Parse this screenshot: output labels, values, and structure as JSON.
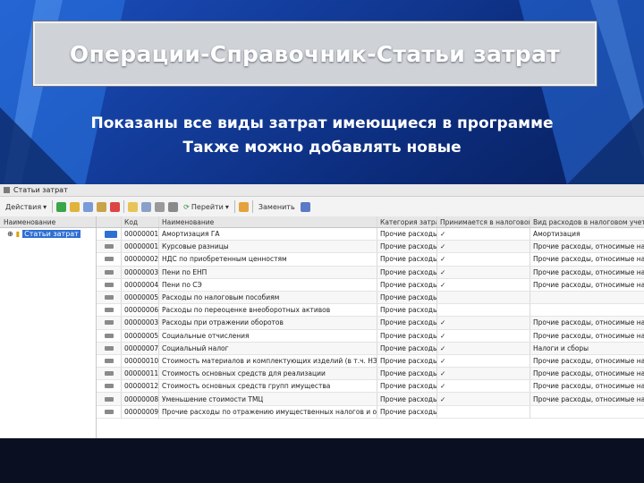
{
  "slide": {
    "title": "Операции-Справочник-Статьи затрат",
    "subtitle_line1": "Показаны все виды затрат имеющиеся в программе",
    "subtitle_line2": "Также можно добавлять новые"
  },
  "window": {
    "title": "Статьи затрат",
    "toolbar": {
      "actions_label": "Действия",
      "goto_label": "Перейти",
      "replace_label": "Заменить"
    },
    "tree": {
      "header": "Наименование",
      "root_label": "Статьи затрат"
    },
    "columns": [
      "Код",
      "Наименование",
      "Категория затрат",
      "Принимается в налоговом учете",
      "Вид расходов в налоговом учете"
    ],
    "rows": [
      {
        "code": "00000001",
        "name": "Амортизация ГА",
        "cat": "Прочие расходы",
        "tax": "✓",
        "kind": "Амортизация"
      },
      {
        "code": "00000001",
        "name": "Курсовые разницы",
        "cat": "Прочие расходы",
        "tax": "✓",
        "kind": "Прочие расходы, относимые на счет"
      },
      {
        "code": "00000002",
        "name": "НДС по приобретенным ценностям",
        "cat": "Прочие расходы",
        "tax": "✓",
        "kind": "Прочие расходы, относимые на счет"
      },
      {
        "code": "00000003",
        "name": "Пени по ЕНП",
        "cat": "Прочие расходы",
        "tax": "✓",
        "kind": "Прочие расходы, относимые на счет"
      },
      {
        "code": "00000004",
        "name": "Пени по СЭ",
        "cat": "Прочие расходы",
        "tax": "✓",
        "kind": "Прочие расходы, относимые на счет"
      },
      {
        "code": "00000005",
        "name": "Расходы по налоговым пособиям",
        "cat": "Прочие расходы",
        "tax": "",
        "kind": ""
      },
      {
        "code": "00000006",
        "name": "Расходы по переоценке внеоборотных активов",
        "cat": "Прочие расходы",
        "tax": "",
        "kind": ""
      },
      {
        "code": "00000003",
        "name": "Расходы при отражении оборотов",
        "cat": "Прочие расходы",
        "tax": "✓",
        "kind": "Прочие расходы, относимые на счет"
      },
      {
        "code": "00000005",
        "name": "Социальные отчисления",
        "cat": "Прочие расходы",
        "tax": "✓",
        "kind": "Прочие расходы, относимые на счет"
      },
      {
        "code": "00000007",
        "name": "Социальный налог",
        "cat": "Прочие расходы",
        "tax": "✓",
        "kind": "Налоги и сборы"
      },
      {
        "code": "00000010",
        "name": "Стоимость материалов и комплектующих изделий (в т.ч. НЗ)",
        "cat": "Прочие расходы",
        "tax": "✓",
        "kind": "Прочие расходы, относимые на счет"
      },
      {
        "code": "00000011",
        "name": "Стоимость основных средств для реализации",
        "cat": "Прочие расходы",
        "tax": "✓",
        "kind": "Прочие расходы, относимые на счет"
      },
      {
        "code": "00000012",
        "name": "Стоимость основных средств групп имущества",
        "cat": "Прочие расходы",
        "tax": "✓",
        "kind": "Прочие расходы, относимые на счет"
      },
      {
        "code": "00000008",
        "name": "Уменьшение стоимости ТМЦ",
        "cat": "Прочие расходы",
        "tax": "✓",
        "kind": "Прочие расходы, относимые на счет"
      },
      {
        "code": "00000009",
        "name": "Прочие расходы по отражению имущественных налогов и обязательств",
        "cat": "Прочие расходы",
        "tax": "",
        "kind": ""
      }
    ]
  },
  "colors": {
    "background": "#0a1a4a",
    "title_box": "#cfd2d6",
    "selection": "#2f6fd3"
  }
}
